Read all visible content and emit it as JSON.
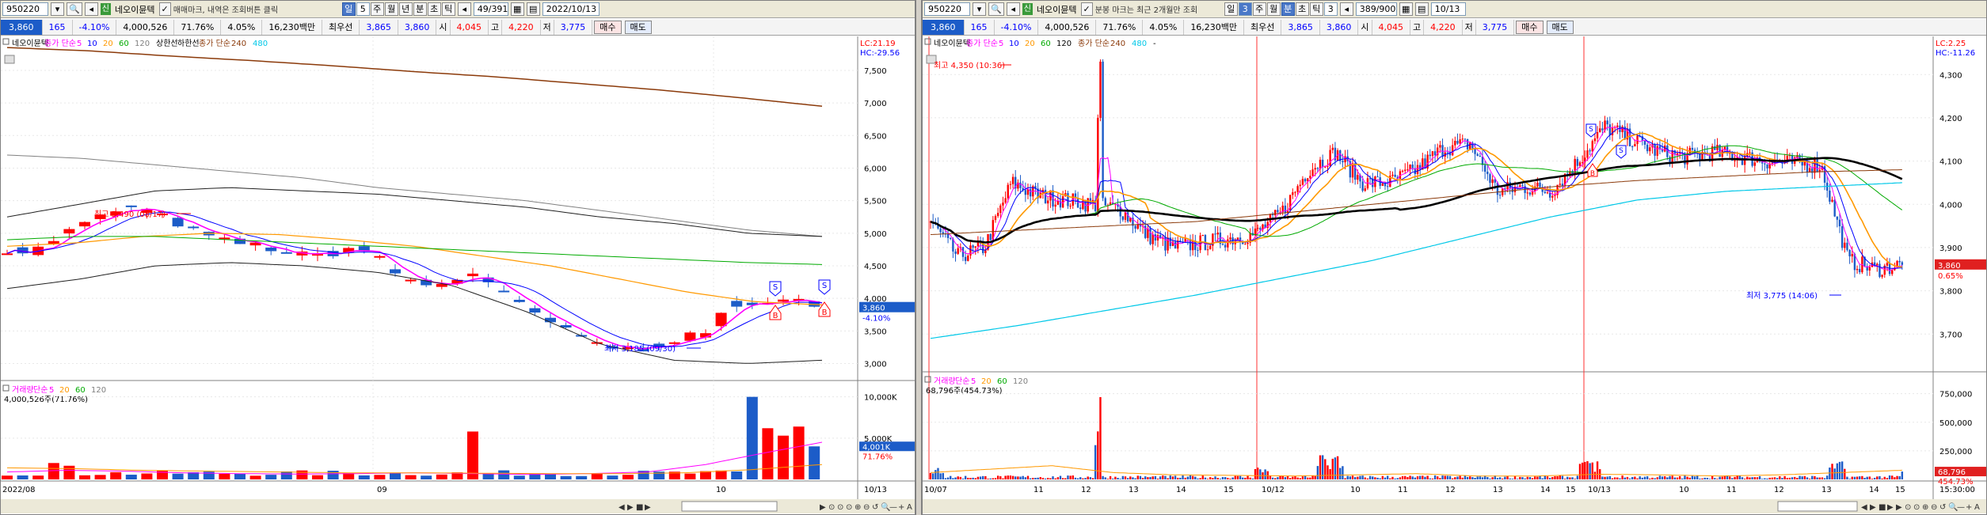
{
  "left": {
    "toolbar": {
      "code": "950220",
      "badge": "신",
      "name": "네오이뮨텍",
      "hint": "매매마크, 내역은 조회버튼 클릭",
      "period_buttons": [
        {
          "label": "일",
          "sel": true
        },
        {
          "label": "5",
          "sel": false,
          "box": true
        },
        {
          "label": "주",
          "sel": false
        },
        {
          "label": "월",
          "sel": false
        },
        {
          "label": "년",
          "sel": false
        },
        {
          "label": "분",
          "sel": false
        },
        {
          "label": "초",
          "sel": false
        },
        {
          "label": "틱",
          "sel": false
        }
      ],
      "count": "49/391",
      "date": "2022/10/13"
    },
    "info": {
      "price": "3,860",
      "change": "165",
      "rate": "-4.10%",
      "volume": "4,000,526",
      "vol_ratio": "71.76%",
      "turnover": "4.05%",
      "amount": "16,230백만",
      "first_label": "최우선",
      "bid": "3,865",
      "ask": "3,860",
      "open_label": "시",
      "open": "4,045",
      "high_label": "고",
      "high": "4,220",
      "low_label": "저",
      "low": "3,775",
      "buy": "매수",
      "sell": "매도"
    },
    "price_legend": {
      "name": "네오이뮨텍",
      "ma": "종가 단순",
      "p5": "5",
      "p10": "10",
      "p20": "20",
      "p60": "60",
      "p120": "120",
      "extra1": "상한선",
      "extra2": "하한선",
      "ma2": "종가 단순",
      "p240": "240",
      "p480": "480"
    },
    "lc": "LC:21.19",
    "hc": "HC:-29.56",
    "price_axis": [
      "7,500",
      "7,000",
      "6,500",
      "6,000",
      "5,500",
      "5,000",
      "4,500",
      "4,000",
      "3,500",
      "3,000"
    ],
    "current_price": "3,860",
    "current_rate": "-4.10%",
    "max_annot": "최고 5,490 (08/17)",
    "min_annot": "최저 3,185 (09/30)",
    "vol_legend": {
      "name": "거래량",
      "ma": "단순",
      "p5": "5",
      "p20": "20",
      "p60": "60",
      "p120": "120"
    },
    "vol_value": "4,000,526주(71.76%)",
    "vol_axis": [
      "10,000K",
      "5,000K"
    ],
    "vol_current": "4,001K",
    "vol_rate": "71.76%",
    "x_labels": [
      "2022/08",
      "09",
      "10"
    ],
    "x_end": "10/13"
  },
  "right": {
    "toolbar": {
      "code": "950220",
      "badge": "신",
      "name": "네오이뮨텍",
      "hint": "분봉 마크는 최근 2개월만 조회",
      "period_buttons": [
        {
          "label": "일",
          "sel": false
        },
        {
          "label": "3",
          "sel": true,
          "box": true
        },
        {
          "label": "주",
          "sel": false
        },
        {
          "label": "월",
          "sel": false
        },
        {
          "label": "분",
          "sel": true
        },
        {
          "label": "초",
          "sel": false
        },
        {
          "label": "틱",
          "sel": false
        },
        {
          "label": "3",
          "sel": false,
          "box": true
        }
      ],
      "count": "389/900",
      "date": "10/13"
    },
    "info": {
      "price": "3,860",
      "change": "165",
      "rate": "-4.10%",
      "volume": "4,000,526",
      "vol_ratio": "71.76%",
      "turnover": "4.05%",
      "amount": "16,230백만",
      "first_label": "최우선",
      "bid": "3,865",
      "ask": "3,860",
      "open_label": "시",
      "open": "4,045",
      "high_label": "고",
      "high": "4,220",
      "low_label": "저",
      "low": "3,775",
      "buy": "매수",
      "sell": "매도"
    },
    "price_legend": {
      "name": "네오이뮨텍",
      "ma": "종가 단순",
      "p5": "5",
      "p10": "10",
      "p20": "20",
      "p60": "60",
      "p120": "120",
      "ma2": "종가 단순",
      "p240": "240",
      "p480": "480",
      "dash": "-"
    },
    "lc": "LC:2.25",
    "hc": "HC:-11.26",
    "price_axis": [
      "4,300",
      "4,200",
      "4,100",
      "4,000",
      "3,900",
      "3,800",
      "3,700"
    ],
    "current_price": "3,860",
    "current_rate": "0.65%",
    "max_annot": "최고 4,350 (10:36)",
    "min_annot": "최저 3,775 (14:06)",
    "vol_legend": {
      "name": "거래량",
      "ma": "단순",
      "p5": "5",
      "p20": "20",
      "p60": "60",
      "p120": "120"
    },
    "vol_value": "68,796주(454.73%)",
    "vol_axis": [
      "750,000",
      "500,000",
      "250,000"
    ],
    "vol_current": "68,796",
    "vol_rate": "454.73%",
    "x_labels": [
      "10/07",
      "11",
      "12",
      "13",
      "14",
      "15",
      "10/12",
      "10",
      "11",
      "12",
      "13",
      "14",
      "15",
      "10/13",
      "10",
      "11",
      "12",
      "13",
      "14",
      "15"
    ],
    "x_end": "15:30:00"
  },
  "colors": {
    "up": "#ff0000",
    "down": "#1c5cc8",
    "ma5": "#ff00ff",
    "ma10": "#0000ff",
    "ma20": "#ff9900",
    "ma60": "#00aa00",
    "ma120": "#808080",
    "ma240": "#8b3a0a",
    "ma480": "#00c8e8",
    "bb": "#202020"
  },
  "chart_data": [
    {
      "type": "candlestick",
      "series": [
        {
          "name": "네오이뮨텍",
          "values": []
        }
      ],
      "ylim": [
        2800,
        7900
      ],
      "annotations": [
        "최고 5,490 (08/17)",
        "최저 3,185 (09/30)"
      ]
    },
    {
      "type": "candlestick",
      "series": [
        {
          "name": "네오이뮨텍",
          "values": []
        }
      ],
      "ylim": [
        3620,
        4370
      ],
      "annotations": [
        "최고 4,350 (10:36)",
        "최저 3,775 (14:06)"
      ]
    }
  ]
}
